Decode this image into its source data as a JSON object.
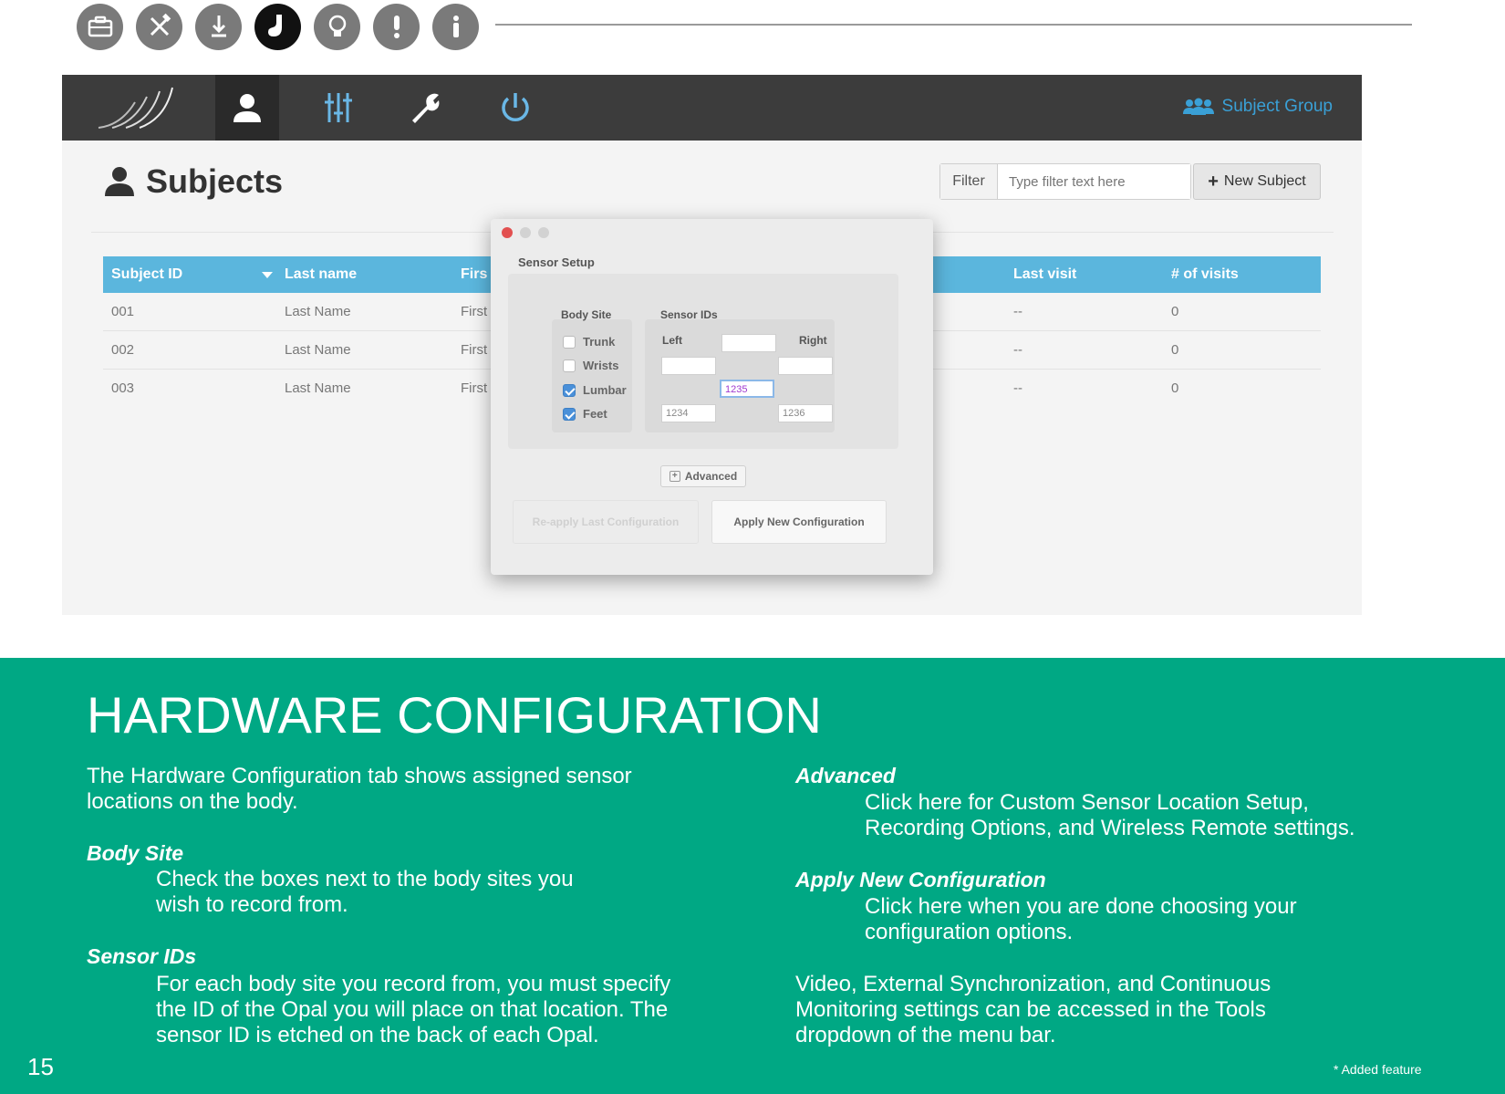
{
  "icon_strip": {
    "icons": [
      "briefcase-icon",
      "tools-icon",
      "download-icon",
      "sock-icon",
      "lightbulb-icon",
      "warning-icon",
      "info-icon"
    ],
    "active_index": 3,
    "active_color": "#111111",
    "inactive_color": "#7a7a7a"
  },
  "app": {
    "nav": {
      "items": [
        "subjects-icon",
        "sliders-icon",
        "wrench-icon",
        "power-icon"
      ],
      "subject_group_label": "Subject Group"
    },
    "page_title": "Subjects",
    "filter": {
      "label": "Filter",
      "placeholder": "Type filter text here"
    },
    "new_subject_label": "New Subject",
    "table": {
      "headers": [
        "Subject ID",
        "Last name",
        "Firs",
        "Last visit",
        "# of visits"
      ],
      "rows": [
        {
          "id": "001",
          "last": "Last Name",
          "first": "First",
          "visit": "--",
          "visits": "0"
        },
        {
          "id": "002",
          "last": "Last Name",
          "first": "First",
          "visit": "--",
          "visits": "0"
        },
        {
          "id": "003",
          "last": "Last Name",
          "first": "First",
          "visit": "--",
          "visits": "0"
        }
      ]
    },
    "dialog": {
      "title": "Sensor Setup",
      "body_site_label": "Body Site",
      "body_sites": [
        {
          "label": "Trunk",
          "checked": false
        },
        {
          "label": "Wrists",
          "checked": false
        },
        {
          "label": "Lumbar",
          "checked": true
        },
        {
          "label": "Feet",
          "checked": true
        }
      ],
      "sensor_ids_label": "Sensor IDs",
      "left_label": "Left",
      "right_label": "Right",
      "center_id": "1235",
      "left_id": "1234",
      "right_id": "1236",
      "advanced_label": "Advanced",
      "reapply_label": "Re-apply Last Configuration",
      "apply_label": "Apply New Configuration"
    }
  },
  "section": {
    "title": "HARDWARE CONFIGURATION",
    "intro_line1": "The Hardware Configuration tab shows assigned sensor",
    "intro_line2": "locations on the body.",
    "body_site_heading": "Body Site",
    "body_site_line1": "Check the boxes next to the body sites you",
    "body_site_line2": "wish to record from.",
    "sensor_ids_heading": "Sensor IDs",
    "sensor_ids_line1": "For each body site you record from, you must specify",
    "sensor_ids_line2": "the ID of the Opal you will place on that location. The",
    "sensor_ids_line3": "sensor ID is etched on the back of each Opal.",
    "advanced_heading": "Advanced",
    "advanced_line1": "Click here for Custom Sensor Location Setup,",
    "advanced_line2": "Recording Options, and Wireless Remote settings.",
    "apply_heading": "Apply New Configuration",
    "apply_line1": "Click here when you are done choosing your",
    "apply_line2": "configuration options.",
    "video_line1": "Video, External Synchronization, and Continuous",
    "video_line2": "Monitoring settings can be accessed in the Tools",
    "video_line3": "dropdown of the menu bar.",
    "page_number": "15",
    "footnote": "* Added feature",
    "background_color": "#00a884"
  }
}
